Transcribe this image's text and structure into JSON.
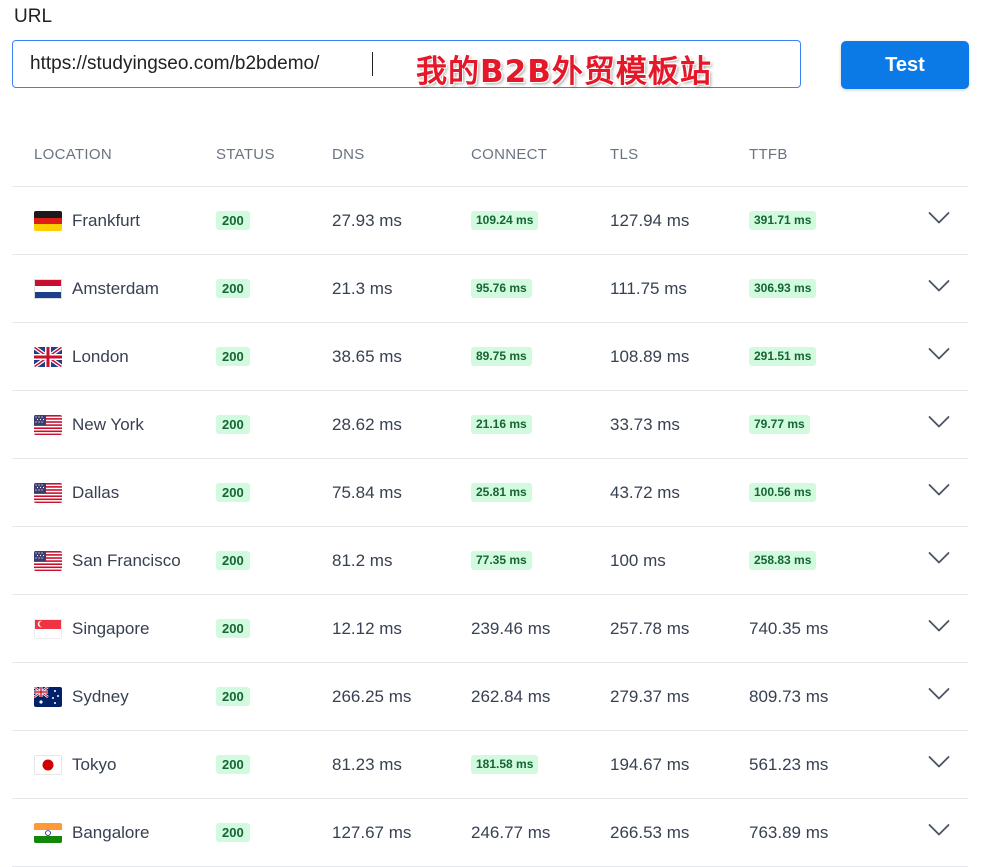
{
  "form": {
    "url_label": "URL",
    "url_value": "https://studyingseo.com/b2bdemo/",
    "annotation": "我的B2B外贸模板站",
    "test_label": "Test"
  },
  "table": {
    "headers": {
      "location": "LOCATION",
      "status": "STATUS",
      "dns": "DNS",
      "connect": "CONNECT",
      "tls": "TLS",
      "ttfb": "TTFB"
    },
    "rows": [
      {
        "flag": "germany",
        "location": "Frankfurt",
        "status": "200",
        "dns": "27.93 ms",
        "connect": "109.24 ms",
        "connect_badge": true,
        "tls": "127.94 ms",
        "ttfb": "391.71 ms",
        "ttfb_badge": true
      },
      {
        "flag": "netherlands",
        "location": "Amsterdam",
        "status": "200",
        "dns": "21.3 ms",
        "connect": "95.76 ms",
        "connect_badge": true,
        "tls": "111.75 ms",
        "ttfb": "306.93 ms",
        "ttfb_badge": true
      },
      {
        "flag": "uk",
        "location": "London",
        "status": "200",
        "dns": "38.65 ms",
        "connect": "89.75 ms",
        "connect_badge": true,
        "tls": "108.89 ms",
        "ttfb": "291.51 ms",
        "ttfb_badge": true
      },
      {
        "flag": "usa",
        "location": "New York",
        "status": "200",
        "dns": "28.62 ms",
        "connect": "21.16 ms",
        "connect_badge": true,
        "tls": "33.73 ms",
        "ttfb": "79.77 ms",
        "ttfb_badge": true
      },
      {
        "flag": "usa",
        "location": "Dallas",
        "status": "200",
        "dns": "75.84 ms",
        "connect": "25.81 ms",
        "connect_badge": true,
        "tls": "43.72 ms",
        "ttfb": "100.56 ms",
        "ttfb_badge": true
      },
      {
        "flag": "usa",
        "location": "San Francisco",
        "status": "200",
        "dns": "81.2 ms",
        "connect": "77.35 ms",
        "connect_badge": true,
        "tls": "100 ms",
        "ttfb": "258.83 ms",
        "ttfb_badge": true
      },
      {
        "flag": "singapore",
        "location": "Singapore",
        "status": "200",
        "dns": "12.12 ms",
        "connect": "239.46 ms",
        "connect_badge": false,
        "tls": "257.78 ms",
        "ttfb": "740.35 ms",
        "ttfb_badge": false
      },
      {
        "flag": "australia",
        "location": "Sydney",
        "status": "200",
        "dns": "266.25 ms",
        "connect": "262.84 ms",
        "connect_badge": false,
        "tls": "279.37 ms",
        "ttfb": "809.73 ms",
        "ttfb_badge": false
      },
      {
        "flag": "japan",
        "location": "Tokyo",
        "status": "200",
        "dns": "81.23 ms",
        "connect": "181.58 ms",
        "connect_badge": true,
        "tls": "194.67 ms",
        "ttfb": "561.23 ms",
        "ttfb_badge": false
      },
      {
        "flag": "india",
        "location": "Bangalore",
        "status": "200",
        "dns": "127.67 ms",
        "connect": "246.77 ms",
        "connect_badge": false,
        "tls": "266.53 ms",
        "ttfb": "763.89 ms",
        "ttfb_badge": false
      }
    ]
  },
  "colors": {
    "accent": "#0b79e6",
    "badge_bg": "#d1fadf",
    "badge_text": "#166534",
    "annotation": "#e5182a"
  }
}
